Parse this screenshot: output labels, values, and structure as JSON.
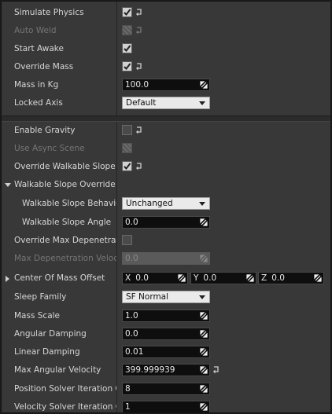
{
  "rows": {
    "simulate_physics": {
      "label": "Simulate Physics"
    },
    "auto_weld": {
      "label": "Auto Weld"
    },
    "start_awake": {
      "label": "Start Awake"
    },
    "override_mass": {
      "label": "Override Mass"
    },
    "mass_in_kg": {
      "label": "Mass in Kg",
      "value": "100.0"
    },
    "locked_axis": {
      "label": "Locked Axis",
      "value": "Default"
    },
    "enable_gravity": {
      "label": "Enable Gravity"
    },
    "use_async_scene": {
      "label": "Use Async Scene"
    },
    "override_walkable_slope": {
      "label": "Override Walkable Slope o"
    },
    "walkable_slope_override": {
      "label": "Walkable Slope Override"
    },
    "walkable_slope_behavior": {
      "label": "Walkable Slope Behavio",
      "value": "Unchanged"
    },
    "walkable_slope_angle": {
      "label": "Walkable Slope Angle",
      "value": "0.0"
    },
    "override_max_depenetration": {
      "label": "Override Max Depenetrati"
    },
    "max_depenetration_velocity": {
      "label": "Max Depenetration Veloci",
      "value": "0.0"
    },
    "center_of_mass_offset": {
      "label": "Center Of Mass Offset",
      "x_label": "X",
      "x": "0.0",
      "y_label": "Y",
      "y": "0.0",
      "z_label": "Z",
      "z": "0.0"
    },
    "sleep_family": {
      "label": "Sleep Family",
      "value": "SF Normal"
    },
    "mass_scale": {
      "label": "Mass Scale",
      "value": "1.0"
    },
    "angular_damping": {
      "label": "Angular Damping",
      "value": "0.0"
    },
    "linear_damping": {
      "label": "Linear Damping",
      "value": "0.01"
    },
    "max_angular_velocity": {
      "label": "Max Angular Velocity",
      "value": "399.999939"
    },
    "position_solver_iteration": {
      "label": "Position Solver Iteration C",
      "value": "8"
    },
    "velocity_solver_iteration": {
      "label": "Velocity Solver Iteration C",
      "value": "1"
    }
  },
  "icons": {
    "reset": "reset-to-default-icon",
    "drag": "drag-handle-icon",
    "check": "checkmark-icon"
  }
}
